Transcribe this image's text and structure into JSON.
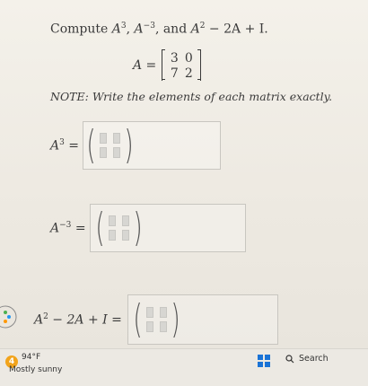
{
  "problem": {
    "prompt_prefix": "Compute ",
    "A": "A",
    "cube_exp": "3",
    "sep1": ", ",
    "neg_cube_exp": "−3",
    "sep2": ", and ",
    "expr_part1": "A",
    "sq_exp": "2",
    "expr_part2": " − 2A + I.",
    "matrix_label": "A =",
    "matrix": [
      "3",
      "0",
      "7",
      "2"
    ],
    "note": "NOTE: Write the elements of each matrix exactly."
  },
  "answers": [
    {
      "label_base": "A",
      "label_exp": "3",
      "label_tail": " ="
    },
    {
      "label_base": "A",
      "label_exp": "−3",
      "label_tail": " ="
    },
    {
      "label_base": "A",
      "label_exp": "2",
      "label_tail": " − 2A + I ="
    }
  ],
  "taskbar": {
    "weather_badge": "4",
    "temperature": "94°F",
    "condition": "Mostly sunny",
    "search_label": "Search"
  }
}
